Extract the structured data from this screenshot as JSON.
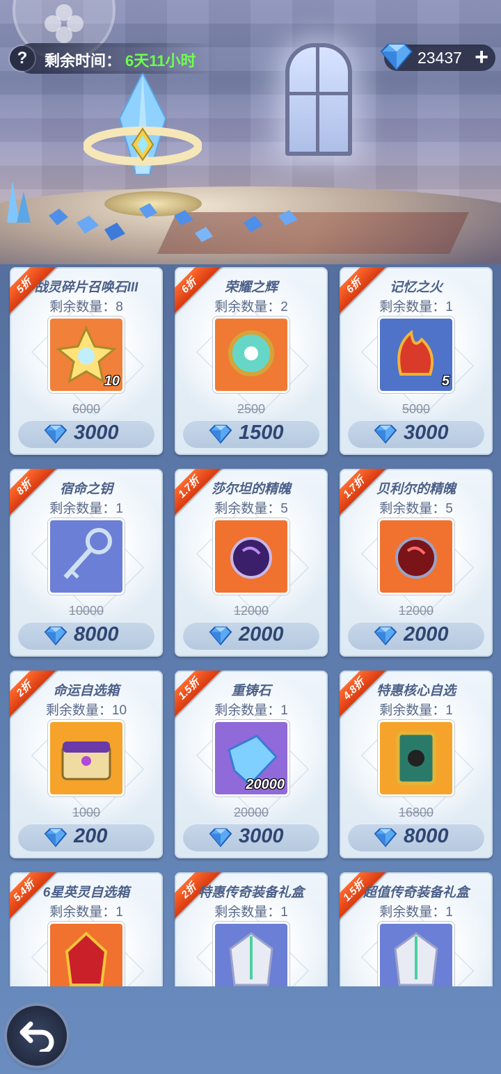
{
  "header": {
    "time_label": "剩余时间：",
    "time_value": "6天11小时",
    "currency_amount": "23437",
    "help_label": "?",
    "add_label": "+"
  },
  "colors": {
    "accent_green": "#6eff4f",
    "ribbon": "#e8471a",
    "price_text": "#2f4673",
    "card_bg": "#eaf2f9"
  },
  "items": [
    {
      "discount": "5折",
      "name": "战灵碎片召唤石III",
      "qty": "剩余数量：8",
      "original": "6000",
      "price": "3000",
      "count": "10",
      "icon": "star-summon-stone-icon",
      "bg": "#f0803a"
    },
    {
      "discount": "6折",
      "name": "荣耀之辉",
      "qty": "剩余数量：2",
      "original": "2500",
      "price": "1500",
      "count": "",
      "icon": "glory-orb-icon",
      "bg": "#f07a33"
    },
    {
      "discount": "6折",
      "name": "记忆之火",
      "qty": "剩余数量：1",
      "original": "5000",
      "price": "3000",
      "count": "5",
      "icon": "memory-flame-icon",
      "bg": "#4e73c8"
    },
    {
      "discount": "8折",
      "name": "宿命之钥",
      "qty": "剩余数量：1",
      "original": "10000",
      "price": "8000",
      "count": "",
      "icon": "destiny-key-icon",
      "bg": "#6c7fd6"
    },
    {
      "discount": "1.7折",
      "name": "莎尔坦的精魄",
      "qty": "剩余数量：5",
      "original": "12000",
      "price": "2000",
      "count": "",
      "icon": "purple-spirit-orb-icon",
      "bg": "#f0722e"
    },
    {
      "discount": "1.7折",
      "name": "贝利尔的精魄",
      "qty": "剩余数量：5",
      "original": "12000",
      "price": "2000",
      "count": "",
      "icon": "red-spirit-orb-icon",
      "bg": "#f0722e"
    },
    {
      "discount": "2折",
      "name": "命运自选箱",
      "qty": "剩余数量：10",
      "original": "1000",
      "price": "200",
      "count": "",
      "icon": "fate-chest-icon",
      "bg": "#f5a32a"
    },
    {
      "discount": "1.5折",
      "name": "重铸石",
      "qty": "剩余数量：1",
      "original": "20000",
      "price": "3000",
      "count": "20000",
      "icon": "reforge-stone-icon",
      "bg": "#8f6ad8"
    },
    {
      "discount": "4.8折",
      "name": "特惠核心自选",
      "qty": "剩余数量：1",
      "original": "16800",
      "price": "8000",
      "count": "",
      "icon": "core-card-icon",
      "bg": "#f5a32a"
    },
    {
      "discount": "5.4折",
      "name": "6星英灵自选箱",
      "qty": "剩余数量：1",
      "original": "",
      "price": "",
      "count": "",
      "icon": "hero-helmet-icon",
      "bg": "#f0722e"
    },
    {
      "discount": "2折",
      "name": "特惠传奇装备礼盒",
      "qty": "剩余数量：1",
      "original": "",
      "price": "",
      "count": "",
      "icon": "legend-armor-icon",
      "bg": "#6c7fd6"
    },
    {
      "discount": "1.5折",
      "name": "超值传奇装备礼盒",
      "qty": "剩余数量：1",
      "original": "",
      "price": "",
      "count": "",
      "icon": "legend-armor-icon",
      "bg": "#6c7fd6"
    }
  ]
}
